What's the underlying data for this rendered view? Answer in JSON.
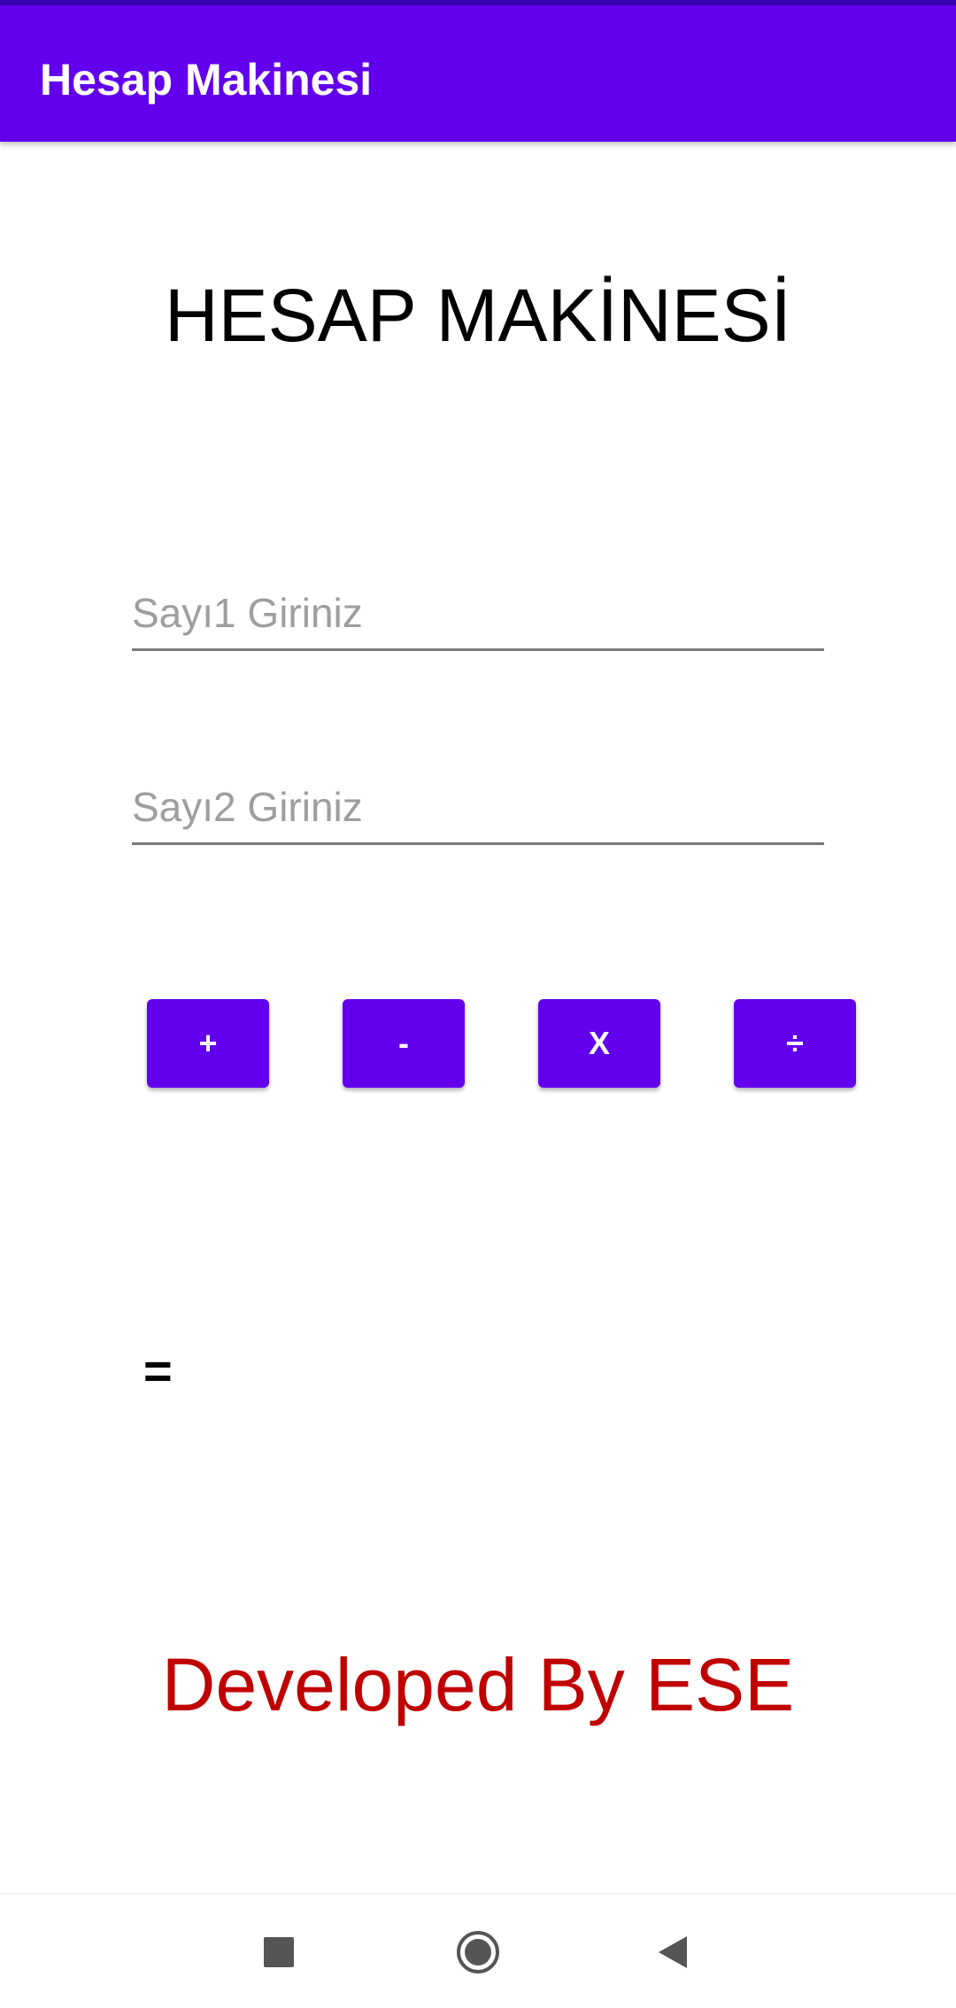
{
  "app_bar": {
    "title": "Hesap Makinesi"
  },
  "main": {
    "heading": "HESAP MAKİNESİ",
    "number1": {
      "placeholder": "Sayı1 Giriniz",
      "value": ""
    },
    "number2": {
      "placeholder": "Sayı2 Giriniz",
      "value": ""
    },
    "operations": {
      "add_label": "+",
      "subtract_label": "-",
      "multiply_label": "X",
      "divide_label": "÷"
    },
    "result": {
      "equals_label": "=",
      "value": ""
    },
    "credit": "Developed By ESE"
  },
  "nav_bar": {
    "icons": [
      "recents-square-icon",
      "home-circle-icon",
      "back-triangle-icon"
    ]
  },
  "colors": {
    "primary": "#6200ee",
    "primary_dark": "#3b00b3",
    "credit_text": "#c00000",
    "placeholder_text": "#9e9e9e",
    "nav_icon": "#555555"
  }
}
